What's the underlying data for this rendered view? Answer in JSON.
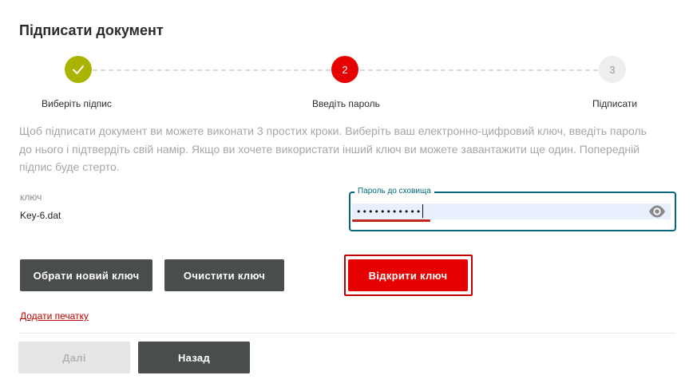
{
  "page": {
    "title": "Підписати документ"
  },
  "stepper": {
    "steps": [
      {
        "label": "Виберіть підпис",
        "state": "completed",
        "icon": "check-icon"
      },
      {
        "label": "Введіть пароль",
        "number": "2",
        "state": "active"
      },
      {
        "label": "Підписати",
        "number": "3",
        "state": "pending"
      }
    ]
  },
  "description": "Щоб підписати документ ви можете виконати 3 простих кроки. Виберіть ваш електронно-цифровий ключ, введіть пароль до нього і підтвердіть свій намір. Якщо ви хочете використати інший ключ ви можете завантажити ще один. Попередній підпис буде стерто.",
  "key": {
    "label": "ключ",
    "value": "Key-6.dat"
  },
  "password": {
    "legend": "Пароль до сховища",
    "value": "•••••••••••",
    "toggle_icon": "eye-icon"
  },
  "buttons": {
    "new_key": "Обрати новий ключ",
    "clear_key": "Очистити ключ",
    "open_key": "Відкрити ключ",
    "next": "Далі",
    "back": "Назад"
  },
  "stamp_link": "Додати печатку",
  "colors": {
    "primary_red": "#e60000",
    "completed_green": "#a8b400",
    "focus_teal": "#00697c",
    "dark_button": "#4a4d4e"
  }
}
